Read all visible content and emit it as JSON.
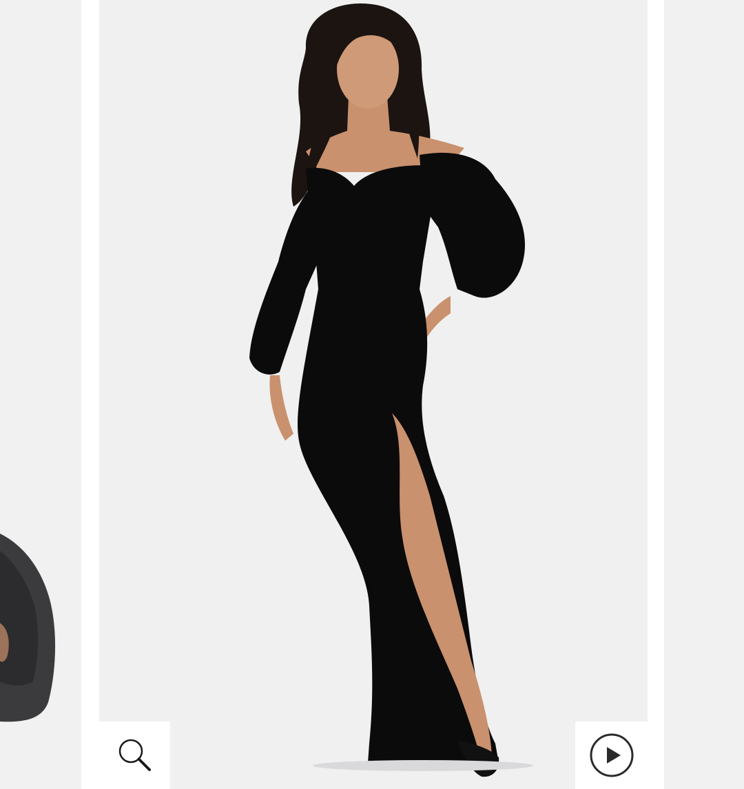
{
  "gallery": {
    "previous_slide": {
      "image": "previous-product-photo-partial"
    },
    "current_slide": {
      "image": "model-wearing-black-off-shoulder-gown",
      "colors": {
        "background": "#f0f0f1",
        "dress": "#0b0b0c",
        "skin": "#c9916d",
        "hair": "#1c1410"
      }
    },
    "next_slide": {
      "image": "next-product-photo-partial"
    },
    "controls": {
      "zoom": {
        "icon": "magnifier-icon"
      },
      "video": {
        "icon": "play-circle-icon"
      }
    }
  }
}
